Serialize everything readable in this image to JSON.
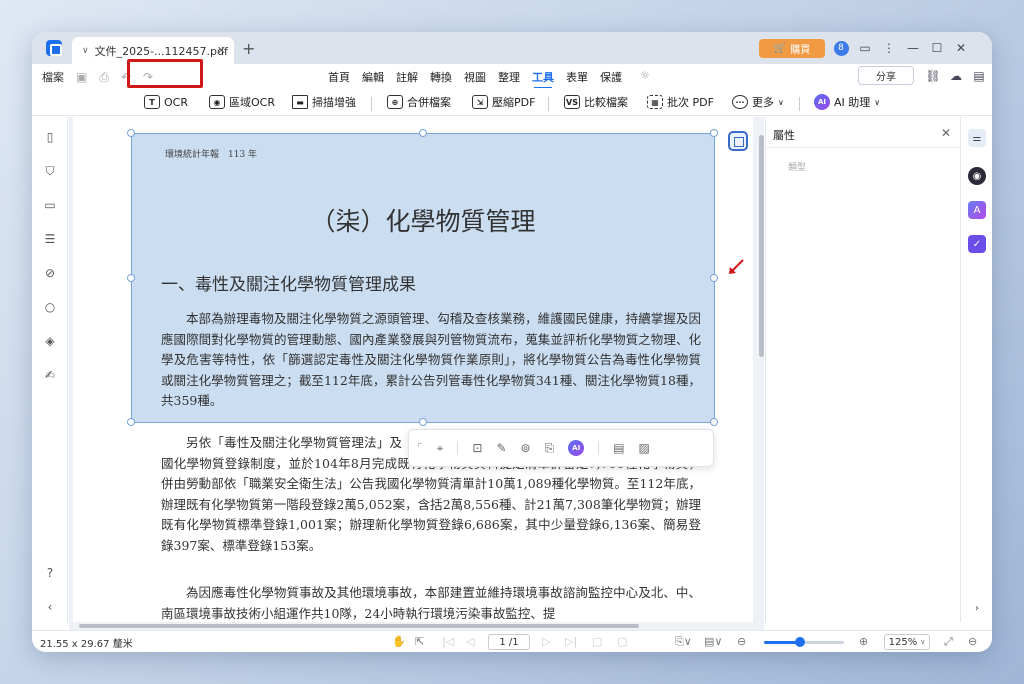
{
  "titlebar": {
    "tab_title": "文件_2025-...112457.pdf",
    "buy_label": "購買",
    "avatar_initial": "8"
  },
  "menubar": {
    "file": "檔案",
    "menus": [
      "首頁",
      "編輯",
      "註解",
      "轉換",
      "視圖",
      "整理",
      "工具",
      "表單",
      "保護"
    ],
    "active_menu": "工具",
    "share": "分享"
  },
  "toolbar": {
    "ocr": "OCR",
    "area_ocr": "區域OCR",
    "scan_enhance": "掃描增強",
    "merge": "合併檔案",
    "compress": "壓縮PDF",
    "compare": "比較檔案",
    "batch": "批次 PDF",
    "more": "更多",
    "ai": "AI 助理"
  },
  "document": {
    "header": "環境統計年報　113 年",
    "title": "（柒）化學物質管理",
    "section": "一、毒性及關注化學物質管理成果",
    "p1": "本部為辦理毒物及關注化學物質之源頭管理、勾稽及查核業務，維護國民健康，持續掌握及因應國際間對化學物質的管理動態、國內產業發展與列管物質流布，蒐集並評析化學物質之物理、化學及危害等特性，依「篩選認定毒性及關注化學物質作業原則」，將化學物質公告為毒性化學物質或關注化學物質管理之；截至112年底，累計公告列管毒性化學物質341種、關注化學物質18種，共359種。",
    "p2": "另依「毒性及關注化學物質管理法」及「新化學物質及既有化學物質資料登錄辦法」，開展我國化學物質登錄制度，並於104年8月完成既有化學物質資料提定清單計審定7,700種化學物質，併由勞動部依「職業安全衛生法」公告我國化學物質清單計10萬1,089種化學物質。至112年底，辦理既有化學物質第一階段登錄2萬5,052案，含括2萬8,556種、計21萬7,308筆化學物質；辦理既有化學物質標準登錄1,001案；辦理新化學物質登錄6,686案，其中少量登錄6,136案、簡易登錄397案、標準登錄153案。",
    "p3": "為因應毒性化學物質事故及其他環境事故，本部建置並維持環境事故諮詢監控中心及北、中、南區環境事故技術小組運作共10隊，24小時執行環境污染事故監控、提"
  },
  "properties": {
    "title": "屬性",
    "field": "類型"
  },
  "statusbar": {
    "dimensions": "21.55 x 29.67 釐米",
    "page": "1 /1",
    "zoom": "125%",
    "zoom_level": 0.45
  },
  "colors": {
    "accent": "#1e6ff0",
    "selection": "#8cb4e1",
    "ocr_highlight": "#d01818",
    "buy": "#f19a44"
  }
}
